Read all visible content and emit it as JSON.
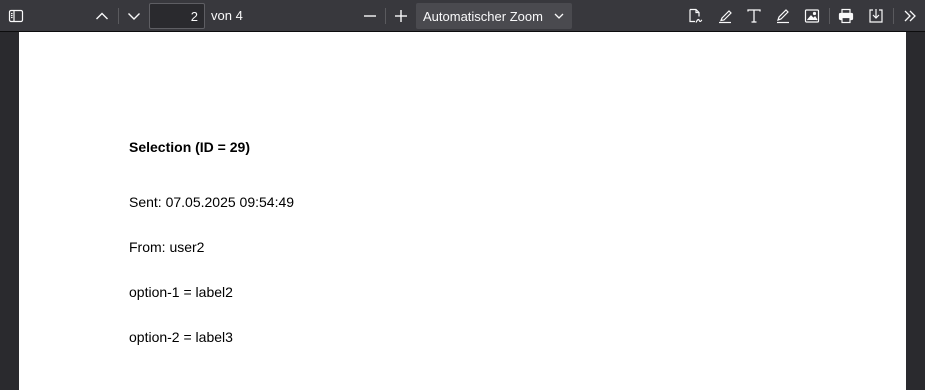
{
  "toolbar": {
    "page_number": "2",
    "page_count_label": "von 4",
    "zoom_value": "Automatischer Zoom",
    "icons": {
      "sidebar": "sidebar-toggle-icon",
      "prev": "chevron-up-icon",
      "next": "chevron-down-icon",
      "zoom_out": "minus-icon",
      "zoom_in": "plus-icon",
      "zoom_dropdown": "chevron-down-icon",
      "signature": "signature-icon",
      "highlight": "highlighter-icon",
      "text": "text-icon",
      "draw": "pen-icon",
      "image": "image-icon",
      "print": "printer-icon",
      "save": "download-icon",
      "more": "double-chevron-right-icon"
    }
  },
  "document": {
    "title": "Selection (ID = 29)",
    "lines": [
      "Sent: 07.05.2025 09:54:49",
      "From: user2",
      "option-1 = label2",
      "option-2 = label3"
    ]
  },
  "colors": {
    "toolbar_bg": "#38383d",
    "viewer_bg": "#2a2a2e",
    "page_bg": "#ffffff",
    "icon": "#f9f9fa"
  }
}
